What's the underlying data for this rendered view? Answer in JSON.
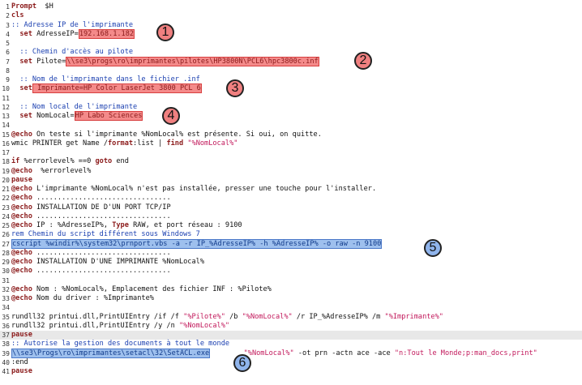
{
  "editor": {
    "lines": [
      {
        "n": "1",
        "segs": [
          [
            "kw",
            "Prompt"
          ],
          [
            "",
            "  $H"
          ]
        ]
      },
      {
        "n": "2",
        "segs": [
          [
            "kw",
            "cls"
          ]
        ]
      },
      {
        "n": "3",
        "segs": [
          [
            "cmt",
            ":: Adresse IP de l'imprimante"
          ]
        ]
      },
      {
        "n": "4",
        "segs": [
          [
            "",
            "  "
          ],
          [
            "kw",
            "set"
          ],
          [
            "",
            " AdresseIP="
          ],
          [
            "hlr",
            "192.168.1.182"
          ]
        ]
      },
      {
        "n": "5",
        "segs": []
      },
      {
        "n": "6",
        "segs": [
          [
            "cmt",
            "  :: Chemin d'accès au pilote"
          ]
        ]
      },
      {
        "n": "7",
        "segs": [
          [
            "",
            "  "
          ],
          [
            "kw",
            "set"
          ],
          [
            "",
            " Pilote="
          ],
          [
            "hlr",
            "\\\\se3\\progs\\ro\\imprimantes\\pilotes\\HP3800N\\PCL6\\hpc3800c.inf"
          ]
        ]
      },
      {
        "n": "8",
        "segs": []
      },
      {
        "n": "9",
        "segs": [
          [
            "cmt",
            "  :: Nom de l'imprimante dans le fichier .inf"
          ]
        ]
      },
      {
        "n": "10",
        "segs": [
          [
            "",
            "  "
          ],
          [
            "kw",
            "set"
          ],
          [
            "hlr",
            " Imprimante=HP Color LaserJet 3800 PCL 6"
          ]
        ]
      },
      {
        "n": "11",
        "segs": []
      },
      {
        "n": "12",
        "segs": [
          [
            "cmt",
            "  :: Nom local de l'imprimante"
          ]
        ]
      },
      {
        "n": "13",
        "segs": [
          [
            "",
            "  "
          ],
          [
            "kw",
            "set"
          ],
          [
            "",
            " NomLocal="
          ],
          [
            "hlr",
            "HP Labo Sciences"
          ]
        ]
      },
      {
        "n": "14",
        "segs": []
      },
      {
        "n": "15",
        "segs": [
          [
            "kw",
            "@echo"
          ],
          [
            "",
            " On teste si l'imprimante %NomLocal% est présente. Si oui, on quitte."
          ]
        ]
      },
      {
        "n": "16",
        "segs": [
          [
            "",
            "wmic PRINTER get Name /"
          ],
          [
            "kw",
            "format"
          ],
          [
            "",
            ":list | "
          ],
          [
            "kw",
            "find"
          ],
          [
            "",
            " "
          ],
          [
            "str",
            "\"%NomLocal%\""
          ]
        ]
      },
      {
        "n": "17",
        "segs": []
      },
      {
        "n": "18",
        "segs": [
          [
            "kw",
            "if"
          ],
          [
            "",
            " %errorlevel% ==0 "
          ],
          [
            "kw",
            "goto"
          ],
          [
            "",
            " end"
          ]
        ]
      },
      {
        "n": "19",
        "segs": [
          [
            "kw",
            "@echo"
          ],
          [
            "",
            "  %errorlevel%"
          ]
        ]
      },
      {
        "n": "20",
        "segs": [
          [
            "kw",
            "pause"
          ]
        ]
      },
      {
        "n": "21",
        "segs": [
          [
            "kw",
            "@echo"
          ],
          [
            "",
            " L'imprimante %NomLocal% n'est pas installée, presser une touche pour l'installer."
          ]
        ]
      },
      {
        "n": "22",
        "segs": [
          [
            "kw",
            "@echo"
          ],
          [
            "",
            " ................................"
          ]
        ]
      },
      {
        "n": "23",
        "segs": [
          [
            "kw",
            "@echo"
          ],
          [
            "",
            " INSTALLATION DE D'UN PORT TCP/IP"
          ]
        ]
      },
      {
        "n": "24",
        "segs": [
          [
            "kw",
            "@echo"
          ],
          [
            "",
            " ................................"
          ]
        ]
      },
      {
        "n": "25",
        "segs": [
          [
            "kw",
            "@echo"
          ],
          [
            "",
            " IP : %AdresseIP%, "
          ],
          [
            "kw",
            "Type"
          ],
          [
            "",
            " RAW, et port réseau : 9100"
          ]
        ]
      },
      {
        "n": "26",
        "segs": [
          [
            "cmt",
            "rem Chemin du script différent sous Windows 7"
          ]
        ]
      },
      {
        "n": "27",
        "segs": [
          [
            "hlb",
            "cscript %windir%\\system32\\prnport.vbs -a -r IP_%AdresseIP% -h %AdresseIP% -o raw -n 9100"
          ]
        ]
      },
      {
        "n": "28",
        "segs": [
          [
            "kw",
            "@echo"
          ],
          [
            "",
            " ................................"
          ]
        ]
      },
      {
        "n": "29",
        "segs": [
          [
            "kw",
            "@echo"
          ],
          [
            "",
            " INSTALLATION D'UNE IMPRIMANTE %NomLocal%"
          ]
        ]
      },
      {
        "n": "30",
        "segs": [
          [
            "kw",
            "@echo"
          ],
          [
            "",
            " ................................"
          ]
        ]
      },
      {
        "n": "31",
        "segs": []
      },
      {
        "n": "32",
        "segs": [
          [
            "kw",
            "@echo"
          ],
          [
            "",
            " Nom : %NomLocal%, Emplacement des fichier INF : %Pilote%"
          ]
        ]
      },
      {
        "n": "33",
        "segs": [
          [
            "kw",
            "@echo"
          ],
          [
            "",
            " Nom du driver : %Imprimante%"
          ]
        ]
      },
      {
        "n": "34",
        "segs": []
      },
      {
        "n": "35",
        "segs": [
          [
            "",
            "rundll32 printui.dll,PrintUIEntry /if /f "
          ],
          [
            "str",
            "\"%Pilote%\""
          ],
          [
            "",
            " /b "
          ],
          [
            "str",
            "\"%NomLocal%\""
          ],
          [
            "",
            " /r IP_%AdresseIP% /m "
          ],
          [
            "str",
            "\"%Imprimante%\""
          ]
        ]
      },
      {
        "n": "36",
        "segs": [
          [
            "",
            "rundll32 printui.dll,PrintUIEntry /y /n "
          ],
          [
            "str",
            "\"%NomLocal%\""
          ]
        ]
      },
      {
        "n": "37",
        "segs": [
          [
            "kw",
            "pause"
          ]
        ],
        "cur": true
      },
      {
        "n": "38",
        "segs": [
          [
            "cmt",
            ":: Autorise la gestion des documents à tout le monde"
          ]
        ]
      },
      {
        "n": "39",
        "segs": [
          [
            "hlb",
            "\\\\se3\\Progs\\ro\\imprimantes\\setacl\\32\\SetACL.exe"
          ],
          [
            "",
            "        "
          ],
          [
            "str",
            "\"%NomLocal%\""
          ],
          [
            "",
            " -ot prn -actn ace -ace "
          ],
          [
            "str",
            "\"n:Tout le Monde;p:man_docs,print\""
          ]
        ]
      },
      {
        "n": "40",
        "segs": [
          [
            "",
            ":end"
          ]
        ]
      },
      {
        "n": "41",
        "segs": [
          [
            "kw",
            "pause"
          ]
        ]
      }
    ]
  },
  "badges": [
    {
      "label": "1",
      "color": "red"
    },
    {
      "label": "2",
      "color": "red"
    },
    {
      "label": "3",
      "color": "red"
    },
    {
      "label": "4",
      "color": "red"
    },
    {
      "label": "5",
      "color": "blue"
    },
    {
      "label": "6",
      "color": "blue"
    }
  ]
}
